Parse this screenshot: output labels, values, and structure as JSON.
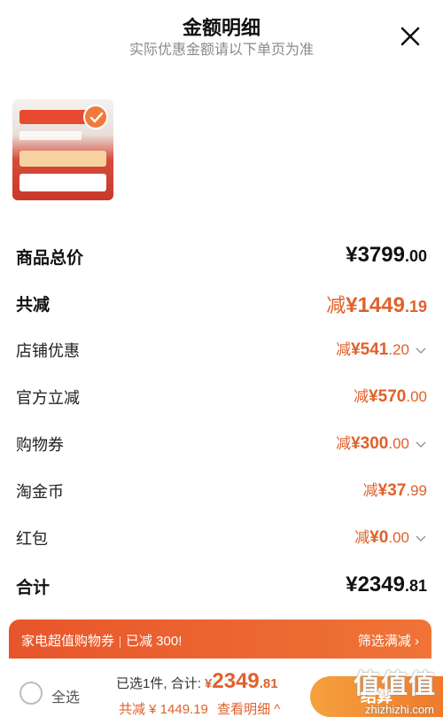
{
  "header": {
    "title": "金额明细",
    "subtitle": "实际优惠金额请以下单页为准"
  },
  "rows": {
    "total_price": {
      "label": "商品总价",
      "currency": "¥",
      "int": "3799",
      "dec": ".00"
    },
    "total_reduce": {
      "label": "共减",
      "prefix": "减",
      "currency": "¥",
      "int": "1449",
      "dec": ".19"
    },
    "shop_discount": {
      "label": "店铺优惠",
      "prefix": "减",
      "currency": "¥",
      "int": "541",
      "dec": ".20"
    },
    "official_reduce": {
      "label": "官方立减",
      "prefix": "减",
      "currency": "¥",
      "int": "570",
      "dec": ".00"
    },
    "shopping_voucher": {
      "label": "购物券",
      "prefix": "减",
      "currency": "¥",
      "int": "300",
      "dec": ".00"
    },
    "taojinbi": {
      "label": "淘金币",
      "prefix": "减",
      "currency": "¥",
      "int": "37",
      "dec": ".99"
    },
    "red_packet": {
      "label": "红包",
      "prefix": "减",
      "currency": "¥",
      "int": "0",
      "dec": ".00"
    },
    "subtotal": {
      "label": "合计",
      "currency": "¥",
      "int": "2349",
      "dec": ".81"
    }
  },
  "promo": {
    "left_a": "家电超值购物券",
    "left_b": "已减 300!",
    "right": "筛选满减 ›"
  },
  "footer": {
    "select_all": "全选",
    "selected": "已选1件,",
    "total_label": "合计:",
    "currency": "¥",
    "total_int": "2349",
    "total_dec": ".81",
    "reduce_text": "共减 ¥ 1449.19",
    "detail_link": "查看明细 ^",
    "checkout": "结算",
    "watermark": "值值值",
    "watermark_url": "zhizhizhi.com"
  },
  "colors": {
    "accent": "#e0602a",
    "promo_start": "#e8552b",
    "promo_end": "#ef7436"
  }
}
